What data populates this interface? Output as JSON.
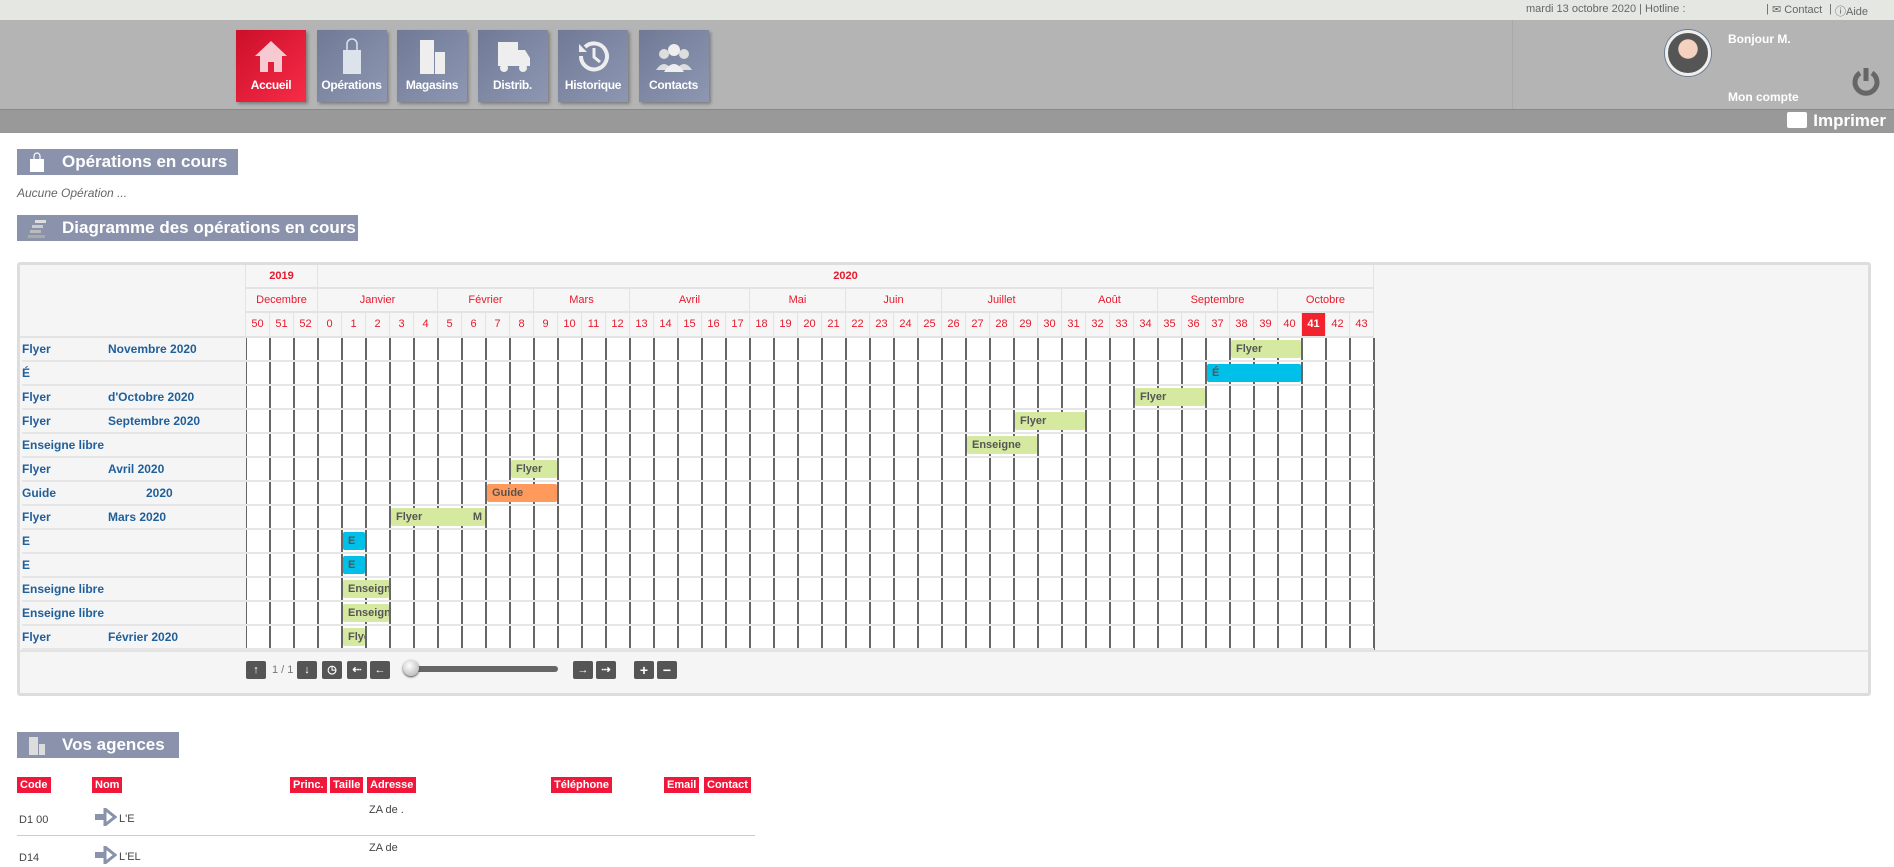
{
  "topbar": {
    "date_hotline": "mardi 13 octobre 2020 | Hotline :",
    "sep": "|",
    "contact": "Contact",
    "sep2": "|",
    "aide": "Aide"
  },
  "nav": [
    {
      "label": "Accueil",
      "icon": "home-icon",
      "active": true
    },
    {
      "label": "Opérations",
      "icon": "shopping-bag-icon"
    },
    {
      "label": "Magasins",
      "icon": "building-icon"
    },
    {
      "label": "Distrib.",
      "icon": "truck-icon"
    },
    {
      "label": "Historique",
      "icon": "history-icon"
    },
    {
      "label": "Contacts",
      "icon": "users-icon"
    }
  ],
  "user": {
    "greeting": "Bonjour M.",
    "account": "Mon compte"
  },
  "print_label": "Imprimer",
  "operations": {
    "title": "Opérations en cours",
    "empty": "Aucune Opération ..."
  },
  "gantt": {
    "title": "Diagramme des opérations en cours",
    "years": [
      {
        "label": "2019",
        "span": 3
      },
      {
        "label": "2020",
        "span": 44
      }
    ],
    "months": [
      {
        "label": "Decembre",
        "span": 3
      },
      {
        "label": "Janvier",
        "span": 5
      },
      {
        "label": "Février",
        "span": 4
      },
      {
        "label": "Mars",
        "span": 4
      },
      {
        "label": "Avril",
        "span": 5
      },
      {
        "label": "Mai",
        "span": 4
      },
      {
        "label": "Juin",
        "span": 4
      },
      {
        "label": "Juillet",
        "span": 5
      },
      {
        "label": "Août",
        "span": 4
      },
      {
        "label": "Septembre",
        "span": 5
      },
      {
        "label": "Octobre",
        "span": 4
      }
    ],
    "weeks": [
      "50",
      "51",
      "52",
      "0",
      "1",
      "2",
      "3",
      "4",
      "5",
      "6",
      "7",
      "8",
      "9",
      "10",
      "11",
      "12",
      "13",
      "14",
      "15",
      "16",
      "17",
      "18",
      "19",
      "20",
      "21",
      "22",
      "23",
      "24",
      "25",
      "26",
      "27",
      "28",
      "29",
      "30",
      "31",
      "32",
      "33",
      "34",
      "35",
      "36",
      "37",
      "38",
      "39",
      "40",
      "41",
      "42",
      "43"
    ],
    "current_week": "41",
    "colors": {
      "green": "#d6e9a0",
      "blue": "#00bfe8",
      "orange": "#ff9a5c",
      "current": "#f0232f"
    },
    "rows": [
      {
        "type": "Flyer",
        "name": "Novembre 2020",
        "bar": {
          "label": "Flyer",
          "start": "38",
          "end": "40",
          "color": "green"
        }
      },
      {
        "type": "É",
        "name": "",
        "bar": {
          "label": "É",
          "start": "37",
          "end": "40",
          "color": "blue"
        }
      },
      {
        "type": "Flyer",
        "name": "d'Octobre 2020",
        "bar": {
          "label": "Flyer",
          "start": "34",
          "end": "36",
          "color": "green"
        }
      },
      {
        "type": "Flyer",
        "name": "Septembre 2020",
        "bar": {
          "label": "Flyer",
          "start": "29",
          "end": "31",
          "color": "green"
        }
      },
      {
        "type": "Enseigne libre",
        "name": "",
        "bar": {
          "label": "Enseigne",
          "start": "27",
          "end": "29",
          "color": "green"
        }
      },
      {
        "type": "Flyer",
        "name": "Avril 2020",
        "bar": {
          "label": "Flyer",
          "start": "8",
          "end": "9",
          "color": "green"
        }
      },
      {
        "type": "Guide",
        "name": "2020",
        "bar": {
          "label": "Guide",
          "start": "7",
          "end": "9",
          "color": "orange"
        }
      },
      {
        "type": "Flyer",
        "name": "Mars 2020",
        "bar": {
          "label": "Flyer",
          "tail": "M",
          "start": "3",
          "end": "6",
          "color": "green"
        }
      },
      {
        "type": "E",
        "name": "",
        "bar": {
          "label": "E",
          "start": "1",
          "end": "1",
          "color": "blue"
        }
      },
      {
        "type": "E",
        "name": "",
        "bar": {
          "label": "E",
          "start": "1",
          "end": "1",
          "color": "blue"
        }
      },
      {
        "type": "Enseigne libre",
        "name": "",
        "bar": {
          "label": "Enseigne",
          "start": "1",
          "end": "2",
          "color": "green"
        }
      },
      {
        "type": "Enseigne libre",
        "name": "",
        "bar": {
          "label": "Enseigne",
          "start": "1",
          "end": "2",
          "color": "green"
        }
      },
      {
        "type": "Flyer",
        "name": "Février 2020",
        "bar": {
          "label": "Flyer",
          "start": "1",
          "end": "1",
          "color": "green"
        }
      }
    ],
    "pager": "1 / 1",
    "slider_value": 0
  },
  "agencies": {
    "title": "Vos agences",
    "headers": [
      "Code",
      "Nom",
      "Princ.",
      "Taille",
      "Adresse",
      "Téléphone",
      "Email",
      "Contact"
    ],
    "rows": [
      {
        "code": "D1   00",
        "name": "L'E",
        "address": "ZA de ."
      },
      {
        "code": "D14",
        "name": "L'EL",
        "address": "ZA de"
      }
    ]
  }
}
